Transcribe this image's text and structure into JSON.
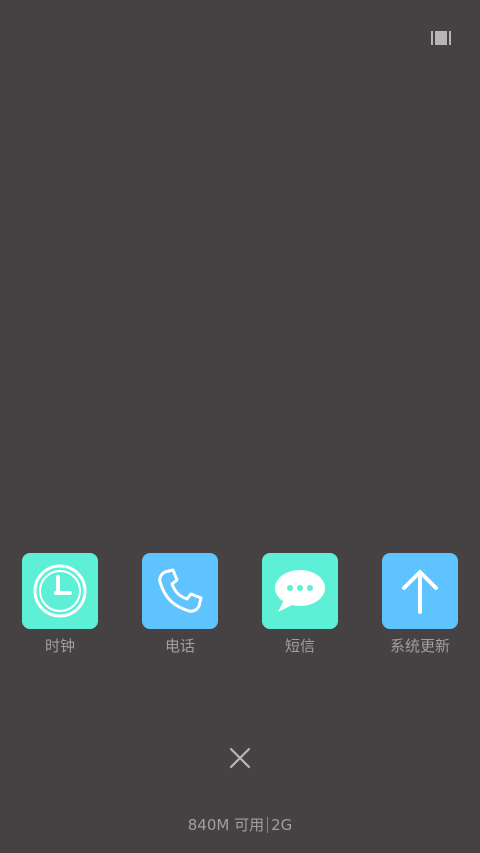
{
  "colors": {
    "background": "#464143",
    "tile_mint": "#5EF0D6",
    "tile_blue": "#5EC3FE",
    "label_text": "#A39EA0"
  },
  "apps": [
    {
      "label": "时钟",
      "icon": "clock-icon"
    },
    {
      "label": "电话",
      "icon": "phone-icon"
    },
    {
      "label": "短信",
      "icon": "message-icon"
    },
    {
      "label": "系统更新",
      "icon": "arrow-up-icon"
    }
  ],
  "memory": {
    "available": "840M 可用",
    "total": "2G"
  },
  "controls": {
    "toggle_icon": "list-view-icon",
    "close_icon": "close-icon"
  }
}
